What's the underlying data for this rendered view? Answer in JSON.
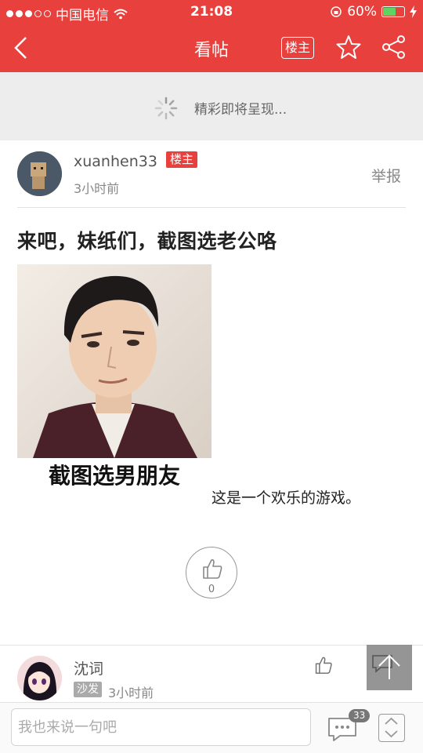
{
  "status": {
    "carrier": "中国电信",
    "time": "21:08",
    "battery": "60%"
  },
  "nav": {
    "title": "看帖",
    "owner_label": "楼主"
  },
  "loading": {
    "text": "精彩即将呈现..."
  },
  "post": {
    "author": "xuanhen33",
    "author_tag": "楼主",
    "time": "3小时前",
    "report_label": "举报",
    "title": "来吧，妹纸们，截图选老公咯",
    "image_caption": "截图选男朋友",
    "body": "这是一个欢乐的游戏。",
    "like_count": "0"
  },
  "reply": {
    "author": "沈词",
    "floor_tag": "沙发",
    "time": "3小时前"
  },
  "bottom": {
    "input_placeholder": "我也来说一句吧",
    "comment_count": "33"
  },
  "colors": {
    "accent": "#e8403d",
    "background": "#ffffff",
    "loading_bg": "#ededed"
  },
  "icons": [
    "back-icon",
    "star-icon",
    "share-icon",
    "spinner-icon",
    "thumb-up-icon",
    "comment-icon",
    "scroll-switch-icon",
    "arrow-up-icon",
    "wifi-icon",
    "signal-dots-icon",
    "rotation-lock-icon",
    "charging-icon"
  ]
}
